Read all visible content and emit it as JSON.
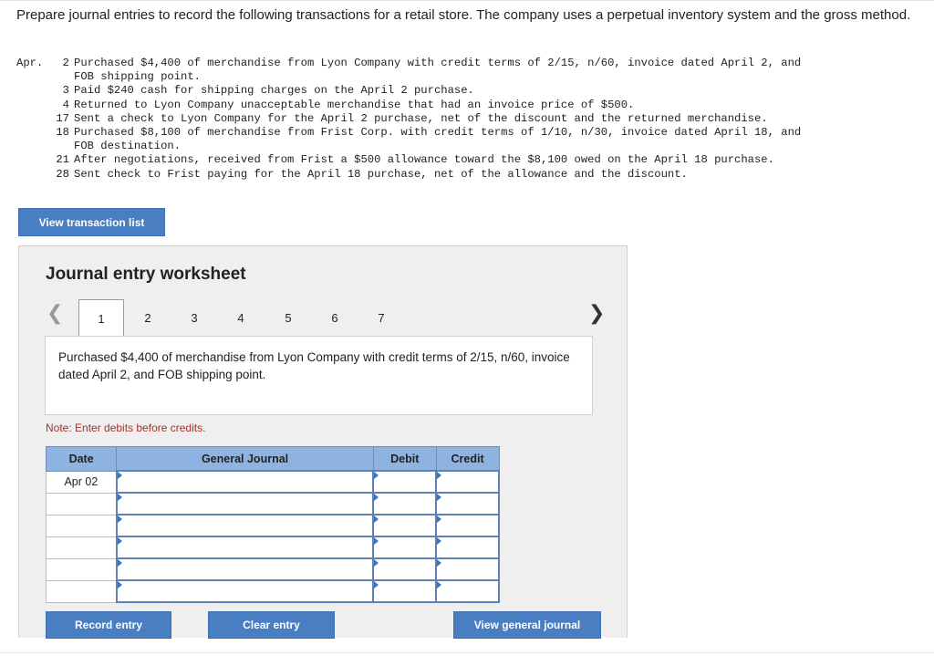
{
  "instructions": "Prepare journal entries to record the following transactions for a retail store. The company uses a perpetual inventory system and the gross method.",
  "transactions": {
    "month": "Apr.",
    "items": [
      {
        "day": "2",
        "lines": [
          "Purchased $4,400 of merchandise from Lyon Company with credit terms of 2/15, n/60, invoice dated April 2, and",
          "FOB shipping point."
        ]
      },
      {
        "day": "3",
        "lines": [
          "Paid $240 cash for shipping charges on the April 2 purchase."
        ]
      },
      {
        "day": "4",
        "lines": [
          "Returned to Lyon Company unacceptable merchandise that had an invoice price of $500."
        ]
      },
      {
        "day": "17",
        "lines": [
          "Sent a check to Lyon Company for the April 2 purchase, net of the discount and the returned merchandise."
        ]
      },
      {
        "day": "18",
        "lines": [
          "Purchased $8,100 of merchandise from Frist Corp. with credit terms of 1/10, n/30, invoice dated April 18, and",
          "FOB destination."
        ]
      },
      {
        "day": "21",
        "lines": [
          "After negotiations, received from Frist a $500 allowance toward the $8,100 owed on the April 18 purchase."
        ]
      },
      {
        "day": "28",
        "lines": [
          "Sent check to Frist paying for the April 18 purchase, net of the allowance and the discount."
        ]
      }
    ]
  },
  "buttons": {
    "view_transaction_list": "View transaction list",
    "record_entry": "Record entry",
    "clear_entry": "Clear entry",
    "view_general_journal": "View general journal"
  },
  "worksheet": {
    "title": "Journal entry worksheet",
    "tabs": [
      "1",
      "2",
      "3",
      "4",
      "5",
      "6",
      "7"
    ],
    "active_tab": "1",
    "description": "Purchased $4,400 of merchandise from Lyon Company with credit terms of 2/15, n/60, invoice dated April 2, and FOB shipping point.",
    "note": "Note: Enter debits before credits.",
    "table": {
      "headers": [
        "Date",
        "General Journal",
        "Debit",
        "Credit"
      ],
      "rows": [
        {
          "date": "Apr 02",
          "account": "",
          "debit": "",
          "credit": ""
        },
        {
          "date": "",
          "account": "",
          "debit": "",
          "credit": ""
        },
        {
          "date": "",
          "account": "",
          "debit": "",
          "credit": ""
        },
        {
          "date": "",
          "account": "",
          "debit": "",
          "credit": ""
        },
        {
          "date": "",
          "account": "",
          "debit": "",
          "credit": ""
        },
        {
          "date": "",
          "account": "",
          "debit": "",
          "credit": ""
        }
      ]
    }
  },
  "icons": {
    "prev": "chevron-left-icon",
    "next": "chevron-right-icon"
  },
  "colors": {
    "button": "#4a7ec2",
    "table_header": "#8fb3e0",
    "note": "#a8312a"
  }
}
